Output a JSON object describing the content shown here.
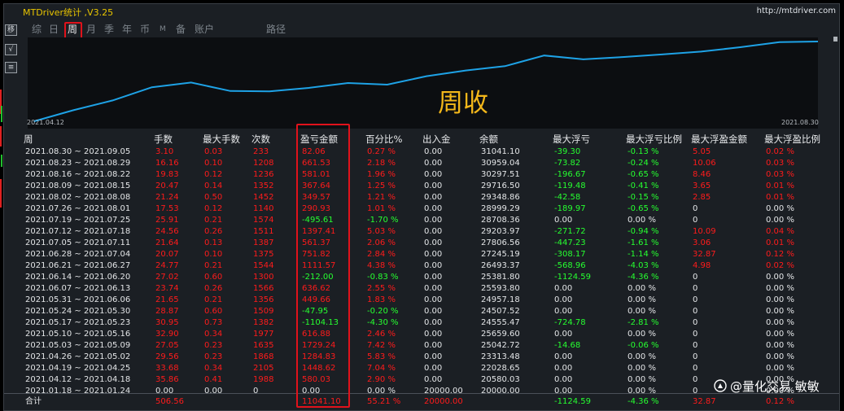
{
  "window": {
    "title": "MTDriver统计 ,V3.25",
    "url": "http://mtdriver.com"
  },
  "side_buttons": [
    {
      "label": "移",
      "icon": "move-icon"
    },
    {
      "label": "√",
      "icon": "check-icon"
    },
    {
      "label": "≡",
      "icon": "list-icon"
    }
  ],
  "tabs": [
    "综",
    "日",
    "周",
    "月",
    "季",
    "年",
    "币",
    "M",
    "备",
    "账户",
    "路径"
  ],
  "active_tab": "周",
  "chart": {
    "label": "周收",
    "start_date": "2021.04.12",
    "end_date": "2021.08.30",
    "line_color": "#1ea2e6",
    "chart_data": {
      "type": "line",
      "x": [
        "2021.04.12",
        "2021.04.19",
        "2021.04.26",
        "2021.05.03",
        "2021.05.10",
        "2021.05.17",
        "2021.05.24",
        "2021.05.31",
        "2021.06.07",
        "2021.06.14",
        "2021.06.21",
        "2021.06.28",
        "2021.07.05",
        "2021.07.12",
        "2021.07.19",
        "2021.07.26",
        "2021.08.02",
        "2021.08.09",
        "2021.08.16",
        "2021.08.23",
        "2021.08.30"
      ],
      "values": [
        20580.03,
        22028.65,
        23313.48,
        25042.72,
        25659.6,
        24555.47,
        24507.52,
        24957.18,
        25593.8,
        25381.8,
        26493.37,
        27245.19,
        27806.56,
        29203.97,
        28708.36,
        28999.29,
        29348.86,
        29716.5,
        30297.51,
        30959.04,
        31041.1
      ]
    }
  },
  "table": {
    "headers": [
      "周",
      "手数",
      "最大手数",
      "次数",
      "盈亏金额",
      "百分比%",
      "出入金",
      "余额",
      "最大浮亏",
      "最大浮亏比例",
      "最大浮盈金额",
      "最大浮盈比例"
    ],
    "rows": [
      [
        "2021.08.30 ~ 2021.09.05",
        "3.10",
        "0.03",
        "233",
        "82.06",
        "0.27 %",
        "0.00",
        "31041.10",
        "-39.30",
        "-0.13 %",
        "5.05",
        "0.02 %"
      ],
      [
        "2021.08.23 ~ 2021.08.29",
        "16.16",
        "0.10",
        "1208",
        "661.53",
        "2.18 %",
        "0.00",
        "30959.04",
        "-73.82",
        "-0.24 %",
        "10.06",
        "0.03 %"
      ],
      [
        "2021.08.16 ~ 2021.08.22",
        "19.83",
        "0.12",
        "1236",
        "581.01",
        "1.96 %",
        "0.00",
        "30297.51",
        "-196.67",
        "-0.65 %",
        "8.46",
        "0.03 %"
      ],
      [
        "2021.08.09 ~ 2021.08.15",
        "20.47",
        "0.14",
        "1352",
        "367.64",
        "1.25 %",
        "0.00",
        "29716.50",
        "-119.48",
        "-0.41 %",
        "3.65",
        "0.01 %"
      ],
      [
        "2021.08.02 ~ 2021.08.08",
        "21.24",
        "0.50",
        "1452",
        "349.57",
        "1.21 %",
        "0.00",
        "29348.86",
        "-42.58",
        "-0.15 %",
        "2.85",
        "0.01 %"
      ],
      [
        "2021.07.26 ~ 2021.08.01",
        "17.53",
        "0.12",
        "1140",
        "290.93",
        "1.01 %",
        "0.00",
        "28999.29",
        "-189.97",
        "-0.65 %",
        "0",
        "0.00 %"
      ],
      [
        "2021.07.19 ~ 2021.07.25",
        "25.91",
        "0.21",
        "1574",
        "-495.61",
        "-1.70 %",
        "0.00",
        "28708.36",
        "0.00",
        "0.00 %",
        "0",
        "0.00 %"
      ],
      [
        "2021.07.12 ~ 2021.07.18",
        "24.56",
        "0.26",
        "1511",
        "1397.41",
        "5.03 %",
        "0.00",
        "29203.97",
        "-271.72",
        "-0.94 %",
        "10.09",
        "0.04 %"
      ],
      [
        "2021.07.05 ~ 2021.07.11",
        "21.64",
        "0.13",
        "1387",
        "561.37",
        "2.06 %",
        "0.00",
        "27806.56",
        "-447.23",
        "-1.61 %",
        "3.06",
        "0.01 %"
      ],
      [
        "2021.06.28 ~ 2021.07.04",
        "20.07",
        "0.10",
        "1375",
        "751.82",
        "2.84 %",
        "0.00",
        "27245.19",
        "-308.17",
        "-1.14 %",
        "32.87",
        "0.12 %"
      ],
      [
        "2021.06.21 ~ 2021.06.27",
        "24.77",
        "0.21",
        "1544",
        "1111.57",
        "4.38 %",
        "0.00",
        "26493.37",
        "-568.96",
        "-4.03 %",
        "4.98",
        "0.02 %"
      ],
      [
        "2021.06.14 ~ 2021.06.20",
        "27.02",
        "0.60",
        "1300",
        "-212.00",
        "-0.83 %",
        "0.00",
        "25381.80",
        "-1124.59",
        "-4.36 %",
        "0",
        "0.00 %"
      ],
      [
        "2021.06.07 ~ 2021.06.13",
        "23.74",
        "0.26",
        "1566",
        "636.62",
        "2.55 %",
        "0.00",
        "25593.80",
        "0.00",
        "0.00 %",
        "0",
        "0.00 %"
      ],
      [
        "2021.05.31 ~ 2021.06.06",
        "21.65",
        "0.21",
        "1356",
        "449.66",
        "1.83 %",
        "0.00",
        "24957.18",
        "0.00",
        "0.00 %",
        "0",
        "0.00 %"
      ],
      [
        "2021.05.24 ~ 2021.05.30",
        "28.87",
        "0.60",
        "1509",
        "-47.95",
        "-0.20 %",
        "0.00",
        "24507.52",
        "0.00",
        "0.00 %",
        "0",
        "0.00 %"
      ],
      [
        "2021.05.17 ~ 2021.05.23",
        "30.95",
        "0.73",
        "1382",
        "-1104.13",
        "-4.30 %",
        "0.00",
        "24555.47",
        "-724.78",
        "-2.81 %",
        "0",
        "0.00 %"
      ],
      [
        "2021.05.10 ~ 2021.05.16",
        "32.90",
        "0.34",
        "1977",
        "616.88",
        "2.46 %",
        "0.00",
        "25659.60",
        "0.00",
        "0.00 %",
        "0",
        "0.00 %"
      ],
      [
        "2021.05.03 ~ 2021.05.09",
        "27.05",
        "0.23",
        "1635",
        "1729.24",
        "7.42 %",
        "0.00",
        "25042.72",
        "-14.68",
        "-0.06 %",
        "0",
        "0.00 %"
      ],
      [
        "2021.04.26 ~ 2021.05.02",
        "29.56",
        "0.23",
        "1868",
        "1284.83",
        "5.83 %",
        "0.00",
        "23313.48",
        "0.00",
        "0.00 %",
        "0",
        "0.00 %"
      ],
      [
        "2021.04.19 ~ 2021.04.25",
        "33.68",
        "0.34",
        "2105",
        "1448.62",
        "7.04 %",
        "0.00",
        "22028.65",
        "0.00",
        "0.00 %",
        "0",
        "0.00 %"
      ],
      [
        "2021.04.12 ~ 2021.04.18",
        "35.86",
        "0.41",
        "1988",
        "580.03",
        "2.90 %",
        "0.00",
        "20580.03",
        "0.00",
        "0.00 %",
        "0",
        "0.00 %"
      ],
      [
        "2021.01.18 ~ 2021.01.24",
        "0.00",
        "0.00",
        "0",
        "0.00",
        "0.00 %",
        "20000.00",
        "20000.00",
        "0.00",
        "0.00 %",
        "0",
        "0.00 %"
      ]
    ],
    "total": [
      "合计",
      "506.56",
      "",
      "",
      "11041.10",
      "55.21 %",
      "20000.00",
      "",
      "-1124.59",
      "-4.36 %",
      "32.87",
      "0.12 %"
    ]
  },
  "watermark": "@量化交易 敏敏",
  "colors": {
    "profit": "#ff1b1b",
    "loss": "#26ff30",
    "neutral": "#e4e6e8",
    "title": "#e8c400",
    "highlight_box": "#e0121b",
    "chart_label": "#f3b71a"
  }
}
